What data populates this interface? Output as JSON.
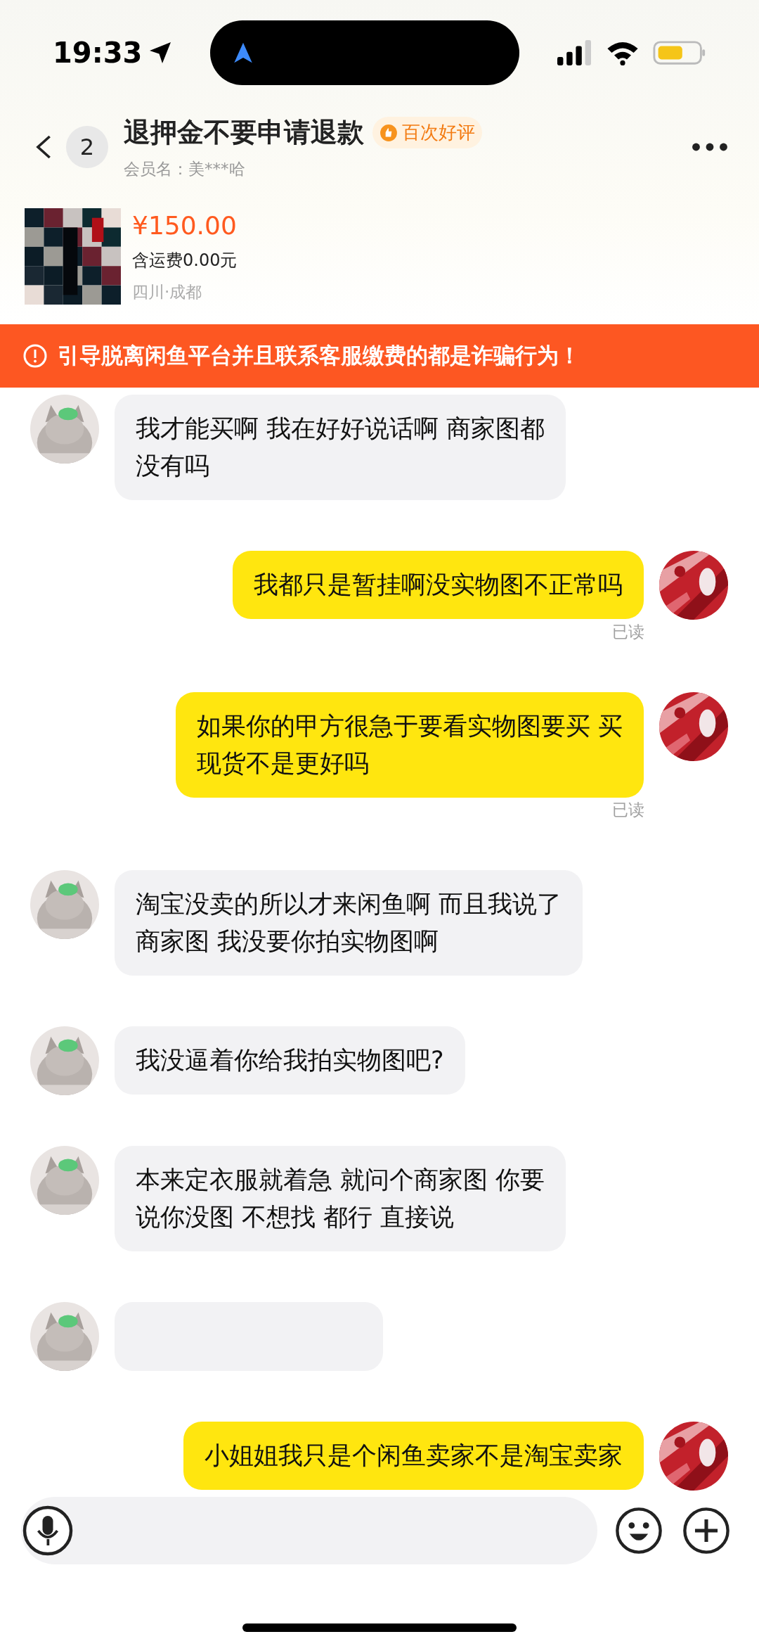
{
  "status_bar": {
    "time": "19:33"
  },
  "header": {
    "unread": "2",
    "title": "退押金不要申请退款",
    "badge": "百次好评",
    "member": "会员名：美***哈"
  },
  "product": {
    "price": "¥150.00",
    "shipping": "含运费0.00元",
    "location": "四川·成都"
  },
  "banner": {
    "text": "引导脱离闲鱼平台并且联系客服缴费的都是诈骗行为！"
  },
  "messages": [
    {
      "outgoing": false,
      "kind": "text",
      "lines": [
        "我才能买啊 我在好好说话啊 商家图都",
        "没有吗"
      ]
    },
    {
      "outgoing": true,
      "kind": "text",
      "lines": [
        "我都只是暂挂啊没实物图不正常吗"
      ],
      "status": "已读"
    },
    {
      "outgoing": true,
      "kind": "text",
      "lines": [
        "如果你的甲方很急于要看实物图要买 买",
        "现货不是更好吗"
      ],
      "status": "已读"
    },
    {
      "outgoing": false,
      "kind": "text",
      "lines": [
        "淘宝没卖的所以才来闲鱼啊 而且我说了",
        "商家图 我没要你拍实物图啊"
      ]
    },
    {
      "outgoing": false,
      "kind": "text",
      "lines": [
        "我没逼着你给我拍实物图吧?"
      ]
    },
    {
      "outgoing": false,
      "kind": "text",
      "lines": [
        "本来定衣服就着急 就问个商家图 你要",
        "说你没图 不想找 都行 直接说"
      ]
    },
    {
      "outgoing": false,
      "kind": "blank"
    },
    {
      "outgoing": true,
      "kind": "text",
      "lines": [
        "小姐姐我只是个闲鱼卖家不是淘宝卖家"
      ]
    }
  ]
}
